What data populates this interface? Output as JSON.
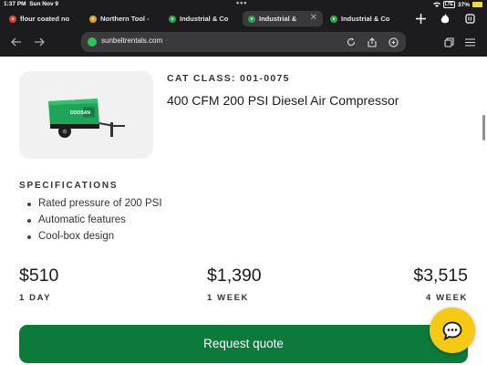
{
  "status_bar": {
    "time": "1:37 PM",
    "date": "Sun Nov 9",
    "network": "LTE",
    "battery": "37%"
  },
  "browser": {
    "tabs": [
      {
        "label": "flour coated no",
        "favicon_color": "#e0452f",
        "active": false
      },
      {
        "label": "Northern Tool -",
        "favicon_color": "#d9a520",
        "active": false
      },
      {
        "label": "Industrial & Co",
        "favicon_color": "#2aa84a",
        "active": false
      },
      {
        "label": "Industrial & ",
        "favicon_color": "#2aa84a",
        "active": true
      },
      {
        "label": "Industrial & Co",
        "favicon_color": "#2aa84a",
        "active": false
      }
    ],
    "url": "sunbeltrentals.com"
  },
  "product": {
    "cat_class": "CAT CLASS: 001-0075",
    "title": "400 CFM 200 PSI Diesel Air Compressor",
    "image_alt_label": "DOOSAN"
  },
  "specifications": {
    "heading": "SPECIFICATIONS",
    "items": [
      "Rated pressure of 200 PSI",
      "Automatic features",
      "Cool-box design"
    ]
  },
  "pricing": [
    {
      "price": "$510",
      "period": "1 DAY"
    },
    {
      "price": "$1,390",
      "period": "1 WEEK"
    },
    {
      "price": "$3,515",
      "period": "4 WEEK"
    }
  ],
  "actions": {
    "request_quote": "Request quote"
  },
  "colors": {
    "brand_green": "#0b7a3b",
    "chat_yellow": "#f6c914",
    "chrome_dark": "#1c1c1e"
  }
}
